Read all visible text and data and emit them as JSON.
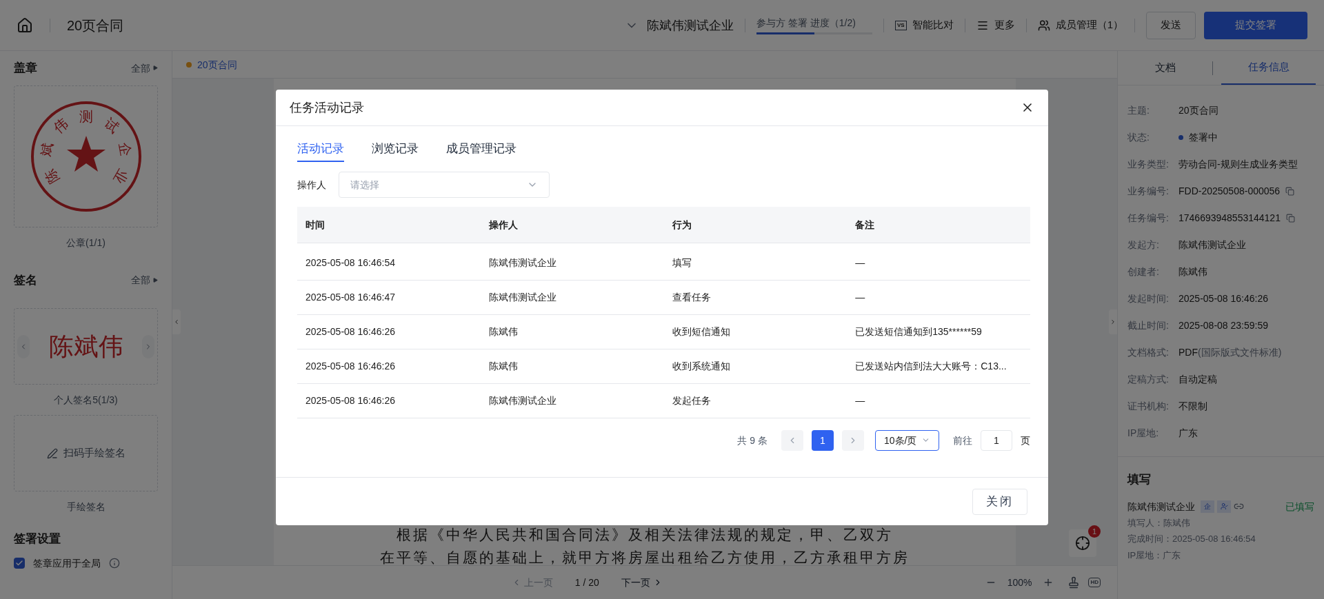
{
  "topbar": {
    "title": "20页合同",
    "company": "陈斌伟测试企业",
    "progress_label": "参与方 签署 进度（1/2)",
    "progress": {
      "level": 0.5
    },
    "actions": [
      {
        "kind": "compare",
        "label": "智能比对",
        "icon_text": "VS"
      },
      {
        "kind": "more",
        "label": "更多"
      },
      {
        "kind": "members",
        "label": "成员管理（1）"
      }
    ],
    "send_button": "发送",
    "submit_button": "提交签署"
  },
  "left_panel": {
    "seal_section": {
      "title": "盖章",
      "all_link": "全部",
      "seal_text": "陈斌伟测试企业",
      "seal_caption": "公章(1/1)"
    },
    "signature_section": {
      "title": "签名",
      "all_link": "全部",
      "signature": "陈斌伟",
      "signature_caption": "个人签名5(1/3)",
      "handwrite_button": "扫码手绘签名",
      "handwrite_caption": "手绘签名"
    },
    "settings": {
      "title": "签署设置",
      "option": {
        "label": "签章应用于全局",
        "checked": true
      }
    }
  },
  "document": {
    "tab": "20页合同",
    "paragraph_lines": [
      "根据《中华人民共和国合同法》及相关法律法规的规定，甲、乙双方",
      "在平等、自愿的基础上，就甲方将房屋出租给乙方使用，乙方承租甲方房"
    ],
    "locate_badge": "1"
  },
  "doc_toolbar": {
    "prev": {
      "label": "上一页",
      "disabled": true
    },
    "page": "1 / 20",
    "next": {
      "label": "下一页",
      "disabled": false
    },
    "zoom": "100%",
    "hd_icon_text": "HD"
  },
  "right_panel": {
    "tabs": [
      {
        "label": "文档",
        "selected": false
      },
      {
        "label": "任务信息",
        "selected": true
      }
    ],
    "info": [
      {
        "label": "主题:",
        "value": "20页合同"
      },
      {
        "label": "状态:",
        "value": "签署中",
        "kind": "status",
        "color": "#182e6a"
      },
      {
        "label": "业务类型:",
        "value": "劳动合同-规则生成业务类型"
      },
      {
        "label": "业务编号:",
        "value": "FDD-20250508-000056",
        "kind": "copy"
      },
      {
        "label": "任务编号:",
        "value": "1746693948553144121",
        "kind": "copy"
      },
      {
        "label": "发起方:",
        "value": "陈斌伟测试企业"
      },
      {
        "label": "创建者:",
        "value": "陈斌伟"
      },
      {
        "label": "发起时间:",
        "value": "2025-05-08 16:46:26"
      },
      {
        "label": "截止时间:",
        "value": "2025-08-08 23:59:59"
      },
      {
        "label": "文档格式:",
        "value": "PDF",
        "note": "(国际版式文件标准)"
      },
      {
        "label": "定稿方式:",
        "value": "自动定稿"
      },
      {
        "label": "证书机构:",
        "value": "不限制"
      },
      {
        "label": "IP屋地:",
        "value": "广东"
      }
    ],
    "fill": {
      "title": "填写",
      "party": "陈斌伟测试企业",
      "enterprise_tag": "企",
      "status": "已填写",
      "lines": [
        "填写人：陈斌伟",
        "完成时间：2025-05-08 16:46:54",
        "IP屋地：广东"
      ]
    }
  },
  "modal": {
    "title": "任务活动记录",
    "tabs": [
      {
        "label": "活动记录",
        "selected": true
      },
      {
        "label": "浏览记录",
        "selected": false
      },
      {
        "label": "成员管理记录",
        "selected": false
      }
    ],
    "filter": {
      "label": "操作人",
      "placeholder": "请选择"
    },
    "table": {
      "columns": [
        "时间",
        "操作人",
        "行为",
        "备注"
      ],
      "rows": [
        [
          "2025-05-08 16:46:54",
          "陈斌伟测试企业",
          "填写",
          "—"
        ],
        [
          "2025-05-08 16:46:47",
          "陈斌伟测试企业",
          "查看任务",
          "—"
        ],
        [
          "2025-05-08 16:46:26",
          "陈斌伟",
          "收到短信通知",
          "已发送短信通知到135******59"
        ],
        [
          "2025-05-08 16:46:26",
          "陈斌伟",
          "收到系统通知",
          "已发送站内信到法大大账号：C13..."
        ],
        [
          "2025-05-08 16:46:26",
          "陈斌伟测试企业",
          "发起任务",
          "—"
        ]
      ]
    },
    "pagination": {
      "total": "共 9 条",
      "pages": [
        {
          "label": "1",
          "selected": true
        }
      ],
      "page_size": "10条/页",
      "goto_label": "前往",
      "goto_value": "1",
      "goto_suffix": "页"
    },
    "close_button": "关闭"
  }
}
